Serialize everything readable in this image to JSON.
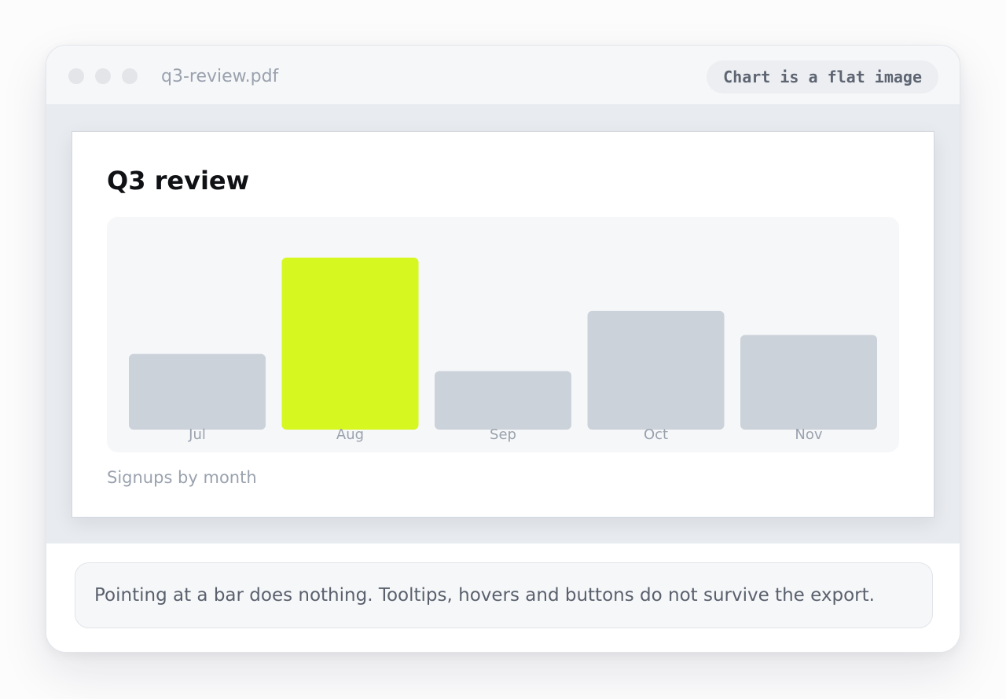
{
  "window": {
    "filename": "q3-review.pdf",
    "badge": "Chart is a flat image"
  },
  "page": {
    "title": "Q3 review",
    "caption": "Signups by month"
  },
  "note": {
    "text": "Pointing at a bar does nothing. Tooltips, hovers and buttons do not survive the export."
  },
  "colors": {
    "highlight": "#d7f720",
    "bar": "#ccd2da",
    "label": "#9aa2ae"
  },
  "chart_data": {
    "type": "bar",
    "categories": [
      "Jul",
      "Aug",
      "Sep",
      "Oct",
      "Nov"
    ],
    "values": [
      44,
      100,
      34,
      69,
      55
    ],
    "highlight_index": 1,
    "grid": false,
    "legend": "none"
  }
}
